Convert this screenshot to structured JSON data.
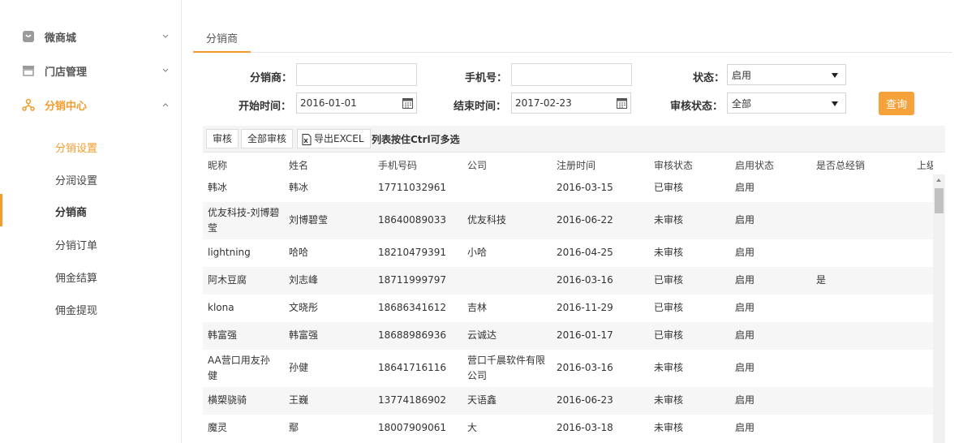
{
  "sidebar": {
    "groups": [
      {
        "label": "微商城",
        "icon": "shop-bag-icon",
        "expanded": false
      },
      {
        "label": "门店管理",
        "icon": "storefront-icon",
        "expanded": false
      },
      {
        "label": "分销中心",
        "icon": "distribution-network-icon",
        "expanded": true
      }
    ],
    "subitems": [
      "分销设置",
      "分润设置",
      "分销商",
      "分销订单",
      "佣金结算",
      "佣金提现"
    ],
    "active_subitem": "分销商"
  },
  "tabs": [
    "分销商"
  ],
  "filters": {
    "distributor_label": "分销商：",
    "distributor_value": "",
    "phone_label": "手机号：",
    "phone_value": "",
    "status_label": "状态：",
    "status_value": "启用",
    "start_label": "开始时间：",
    "start_value": "2016-01-01",
    "end_label": "结束时间：",
    "end_value": "2017-02-23",
    "audit_label": "审核状态：",
    "audit_value": "全部",
    "query_button": "查询"
  },
  "toolbar": {
    "audit_button": "审核",
    "audit_all_button": "全部审核",
    "export_button": "导出EXCEL",
    "hint": "列表按住Ctrl可多选"
  },
  "table": {
    "columns": [
      "昵称",
      "姓名",
      "手机号码",
      "公司",
      "注册时间",
      "审核状态",
      "启用状态",
      "是否总经销",
      "上级"
    ],
    "rows": [
      {
        "nickname": "韩冰",
        "name": "韩冰",
        "phone": "17711032961",
        "company": "",
        "date": "2016-03-15",
        "audit": "已审核",
        "enabled": "启用",
        "master": ""
      },
      {
        "nickname": "优友科技-刘博碧莹",
        "name": "刘博碧莹",
        "phone": "18640089033",
        "company": "优友科技",
        "date": "2016-06-22",
        "audit": "未审核",
        "enabled": "启用",
        "master": ""
      },
      {
        "nickname": "lightning",
        "name": "哈哈",
        "phone": "18210479391",
        "company": "小哈",
        "date": "2016-04-25",
        "audit": "未审核",
        "enabled": "启用",
        "master": ""
      },
      {
        "nickname": "阿木豆腐",
        "name": "刘志峰",
        "phone": "18711999797",
        "company": "",
        "date": "2016-03-16",
        "audit": "已审核",
        "enabled": "启用",
        "master": "是"
      },
      {
        "nickname": "klona",
        "name": "文晓彤",
        "phone": "18686341612",
        "company": "吉林",
        "date": "2016-11-29",
        "audit": "已审核",
        "enabled": "启用",
        "master": ""
      },
      {
        "nickname": "韩富强",
        "name": "韩富强",
        "phone": "18688986936",
        "company": "云诚达",
        "date": "2016-01-17",
        "audit": "已审核",
        "enabled": "启用",
        "master": ""
      },
      {
        "nickname": "AA营口用友孙健",
        "name": "孙健",
        "phone": "18641716116",
        "company": "营口千晨软件有限公司",
        "date": "2016-03-16",
        "audit": "未审核",
        "enabled": "启用",
        "master": ""
      },
      {
        "nickname": "横槊骁骑",
        "name": "王巍",
        "phone": "13774186902",
        "company": "天语鑫",
        "date": "2016-06-23",
        "audit": "未审核",
        "enabled": "启用",
        "master": ""
      },
      {
        "nickname": "魔灵",
        "name": "鄢",
        "phone": "18007909061",
        "company": "大",
        "date": "2016-03-18",
        "audit": "未审核",
        "enabled": "启用",
        "master": ""
      }
    ]
  },
  "colors": {
    "accent": "#f39c2d",
    "button": "#f5a23a"
  }
}
